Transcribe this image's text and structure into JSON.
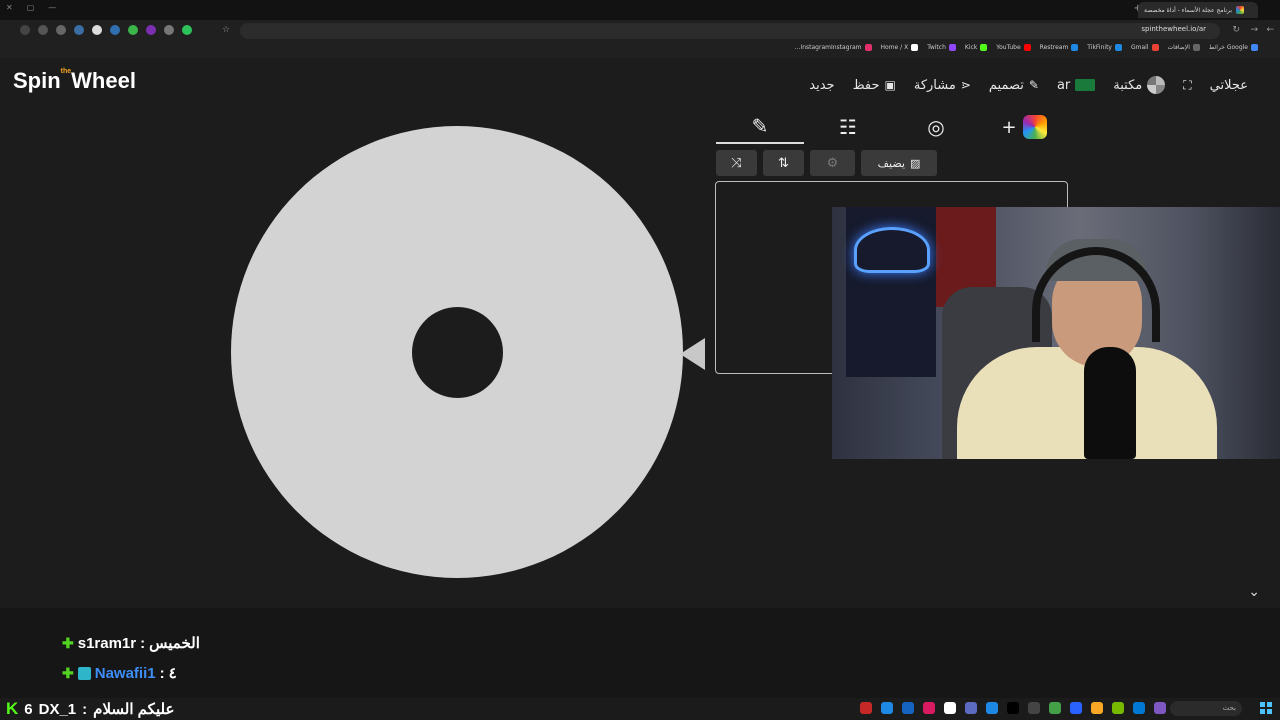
{
  "browser": {
    "tab_title": "برنامج عجلة الأسماء - أداة مخصصة",
    "url": "spinthewheel.io/ar",
    "bookmarks": [
      "Google خرائط",
      "الإضافات",
      "Gmail",
      "TikFinity",
      "Restream",
      "YouTube",
      "Kick",
      "Twitch",
      "Home / X",
      "InstagramInstagram..."
    ]
  },
  "app": {
    "logo_main": "Spin Wheel",
    "logo_the": "the",
    "menu": {
      "my_wheels": "عجلاتي",
      "library": "مكتبة",
      "language": "ar",
      "customize": "تصميم",
      "share": "مشاركة",
      "save": "حفظ",
      "new": "جديد"
    },
    "toolbar": {
      "add_image_label": "يضيف"
    },
    "colors": {
      "wheel": "#d3d3d3",
      "background": "#1c1c1c"
    }
  },
  "chat": {
    "lines": [
      {
        "user": "s1ram1r",
        "message": "الخميس"
      },
      {
        "user": "Nawafii1",
        "message": "٤"
      }
    ],
    "taskbar_line": {
      "count": "6",
      "user": "DX_1",
      "message": "عليكم السلام"
    }
  },
  "taskbar": {
    "search_placeholder": "بحث"
  }
}
